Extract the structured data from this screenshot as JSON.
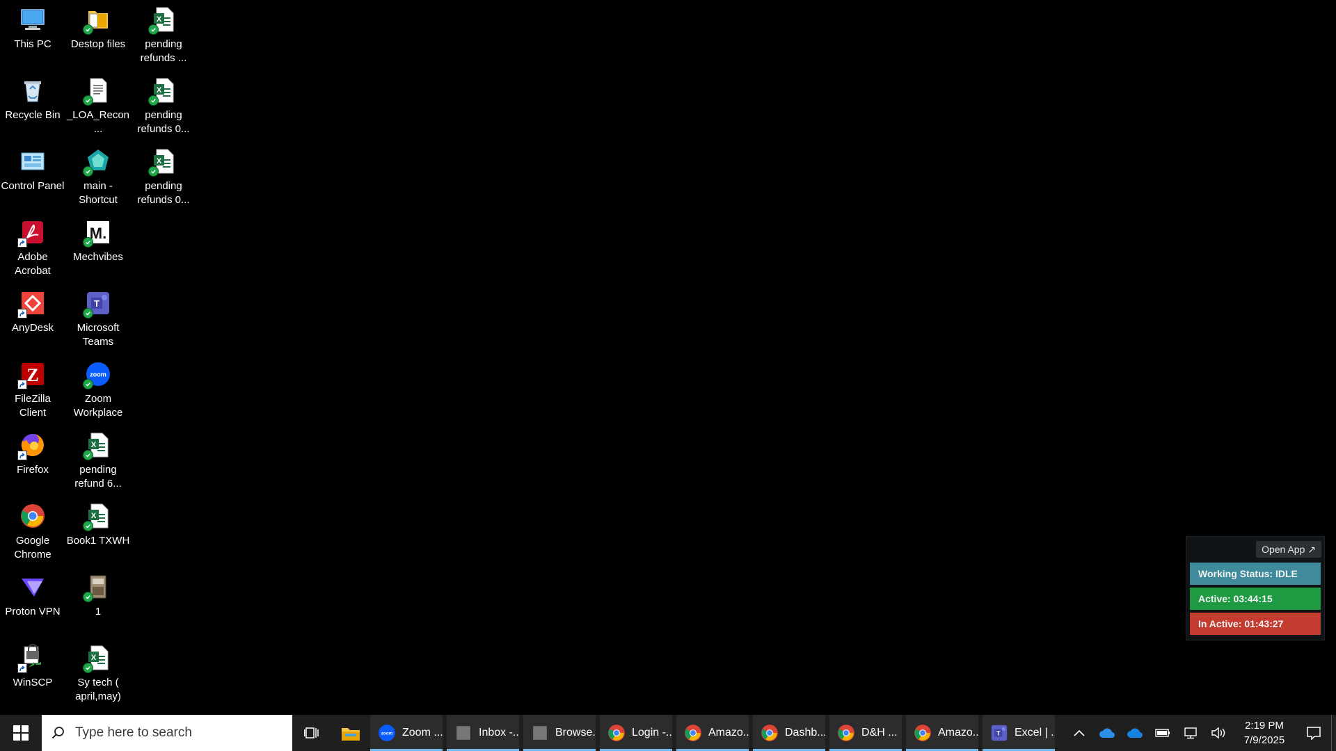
{
  "desktop": {
    "icons": [
      {
        "label": "This PC",
        "icon": "computer-icon",
        "badge": "none"
      },
      {
        "label": "Destop files",
        "icon": "folder-icon",
        "badge": "sync"
      },
      {
        "label": "pending refunds ...",
        "icon": "excel-file-icon",
        "badge": "sync"
      },
      {
        "label": "Recycle Bin",
        "icon": "recycle-bin-icon",
        "badge": "none"
      },
      {
        "label": "_LOA_Recon...",
        "icon": "document-icon",
        "badge": "sync"
      },
      {
        "label": "pending refunds 0...",
        "icon": "excel-file-icon",
        "badge": "sync"
      },
      {
        "label": "Control Panel",
        "icon": "control-panel-icon",
        "badge": "none"
      },
      {
        "label": "main - Shortcut",
        "icon": "app-shortcut-icon",
        "badge": "sync"
      },
      {
        "label": "pending refunds 0...",
        "icon": "excel-file-icon",
        "badge": "sync"
      },
      {
        "label": "Adobe Acrobat",
        "icon": "acrobat-icon",
        "badge": "shortcut"
      },
      {
        "label": "Mechvibes",
        "icon": "mechvibes-icon",
        "badge": "sync"
      },
      {
        "label": "AnyDesk",
        "icon": "anydesk-icon",
        "badge": "shortcut"
      },
      {
        "label": "Microsoft Teams",
        "icon": "teams-icon",
        "badge": "sync"
      },
      {
        "label": "FileZilla Client",
        "icon": "filezilla-icon",
        "badge": "shortcut"
      },
      {
        "label": "Zoom Workplace",
        "icon": "zoom-icon",
        "badge": "sync"
      },
      {
        "label": "Firefox",
        "icon": "firefox-icon",
        "badge": "shortcut"
      },
      {
        "label": "pending refund 6...",
        "icon": "excel-file-icon",
        "badge": "sync"
      },
      {
        "label": "Google Chrome",
        "icon": "chrome-icon",
        "badge": "none"
      },
      {
        "label": "Book1 TXWH",
        "icon": "excel-file-icon",
        "badge": "sync"
      },
      {
        "label": "Proton VPN",
        "icon": "proton-vpn-icon",
        "badge": "none"
      },
      {
        "label": "1",
        "icon": "archive-icon",
        "badge": "sync"
      },
      {
        "label": "WinSCP",
        "icon": "winscp-icon",
        "badge": "shortcut"
      },
      {
        "label": "Sy tech ( april,may)",
        "icon": "excel-file-icon",
        "badge": "sync"
      }
    ]
  },
  "tracker": {
    "open_app_label": "Open App ↗",
    "working_status": "Working Status: IDLE",
    "active": "Active: 03:44:15",
    "inactive": "In Active: 01:43:27"
  },
  "taskbar": {
    "search_placeholder": "Type here to search",
    "apps": [
      {
        "label": "Zoom ...",
        "icon": "zoom-icon",
        "color": "#0b5cff"
      },
      {
        "label": "Inbox -...",
        "icon": "outlook-icon",
        "color": "#0a64c8"
      },
      {
        "label": "Browse...",
        "icon": "outlook-icon",
        "color": "#0a64c8"
      },
      {
        "label": "Login -...",
        "icon": "chrome-icon",
        "color": "#db4437"
      },
      {
        "label": "Amazo...",
        "icon": "chrome-icon",
        "color": "#db4437"
      },
      {
        "label": "Dashb...",
        "icon": "chrome-icon",
        "color": "#db4437"
      },
      {
        "label": "D&H ...",
        "icon": "chrome-icon",
        "color": "#db4437"
      },
      {
        "label": "Amazo...",
        "icon": "chrome-icon",
        "color": "#db4437"
      },
      {
        "label": "Excel | ...",
        "icon": "teams-icon",
        "color": "#5b5fc7"
      }
    ],
    "clock_time": "2:19 PM",
    "clock_date": "7/9/2025"
  }
}
